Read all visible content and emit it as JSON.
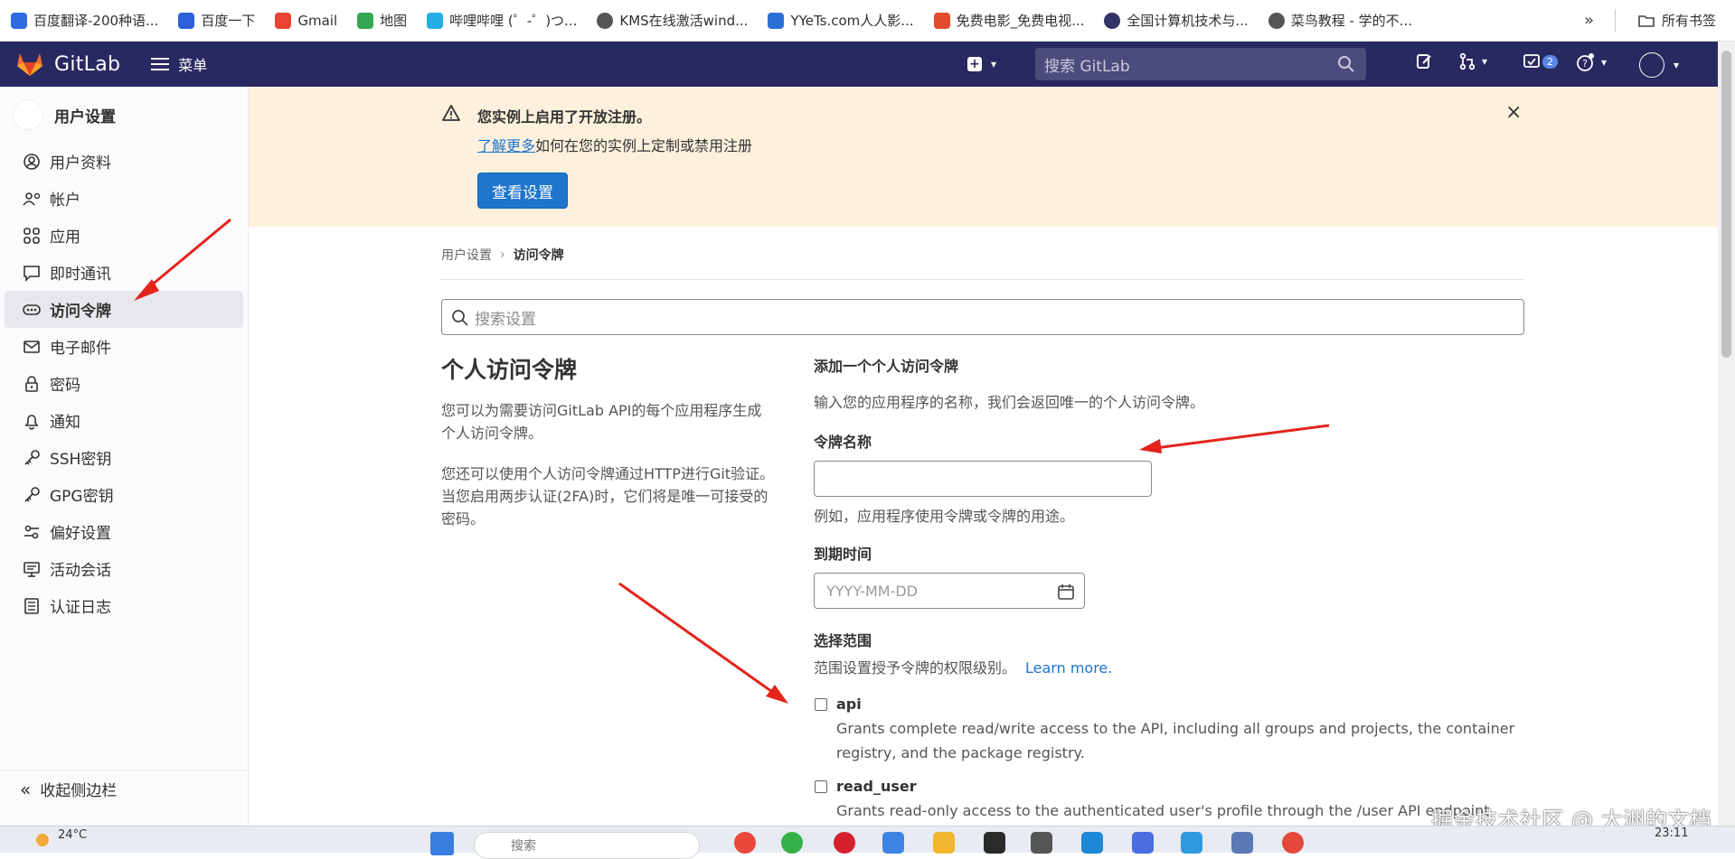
{
  "bookmarks": {
    "items": [
      {
        "label": "百度翻译-200种语...",
        "icon": "translate-icon",
        "color": "#2f6be4"
      },
      {
        "label": "百度一下",
        "icon": "paw-icon",
        "color": "#2f5fd9"
      },
      {
        "label": "Gmail",
        "icon": "gmail-icon",
        "color": "#ea4335"
      },
      {
        "label": "地图",
        "icon": "map-pin-icon",
        "color": "#34a853"
      },
      {
        "label": "哔哩哔哩 (゜-゜)つ...",
        "icon": "bilibili-icon",
        "color": "#23ade5"
      },
      {
        "label": "KMS在线激活wind...",
        "icon": "globe-icon",
        "color": "#555555"
      },
      {
        "label": "YYeTs.com人人影...",
        "icon": "yyets-icon",
        "color": "#2b6fd6"
      },
      {
        "label": "免费电影_免费电视...",
        "icon": "film-icon",
        "color": "#e24b2b"
      },
      {
        "label": "全国计算机技术与...",
        "icon": "seal-icon",
        "color": "#333366"
      },
      {
        "label": "菜鸟教程 - 学的不...",
        "icon": "globe-icon",
        "color": "#555555"
      }
    ],
    "more": "»",
    "all_bookmarks": "所有书签"
  },
  "topnav": {
    "brand": "GitLab",
    "menu": "菜单",
    "search_placeholder": "搜索 GitLab",
    "todo_count": "2"
  },
  "sidebar": {
    "title": "用户设置",
    "items": [
      {
        "label": "用户资料",
        "icon": "profile-icon"
      },
      {
        "label": "帐户",
        "icon": "account-icon"
      },
      {
        "label": "应用",
        "icon": "applications-icon"
      },
      {
        "label": "即时通讯",
        "icon": "chat-icon"
      },
      {
        "label": "访问令牌",
        "icon": "token-icon",
        "active": true
      },
      {
        "label": "电子邮件",
        "icon": "email-icon"
      },
      {
        "label": "密码",
        "icon": "lock-icon"
      },
      {
        "label": "通知",
        "icon": "bell-icon"
      },
      {
        "label": "SSH密钥",
        "icon": "key-icon"
      },
      {
        "label": "GPG密钥",
        "icon": "key-icon"
      },
      {
        "label": "偏好设置",
        "icon": "preferences-icon"
      },
      {
        "label": "活动会话",
        "icon": "monitor-icon"
      },
      {
        "label": "认证日志",
        "icon": "log-icon"
      }
    ],
    "collapse_label": "收起侧边栏"
  },
  "banner": {
    "title": "您实例上启用了开放注册。",
    "link": "了解更多",
    "text": "如何在您的实例上定制或禁用注册",
    "button": "查看设置"
  },
  "breadcrumb": {
    "parent": "用户设置",
    "current": "访问令牌"
  },
  "settings_search": {
    "placeholder": "搜索设置"
  },
  "intro": {
    "title": "个人访问令牌",
    "para1": "您可以为需要访问GitLab API的每个应用程序生成个人访问令牌。",
    "para2": "您还可以使用个人访问令牌通过HTTP进行Git验证。 当您启用两步认证(2FA)时，它们将是唯一可接受的密码。"
  },
  "form": {
    "heading": "添加一个个人访问令牌",
    "description": "输入您的应用程序的名称，我们会返回唯一的个人访问令牌。",
    "name_label": "令牌名称",
    "name_value": "",
    "name_help": "例如，应用程序使用令牌或令牌的用途。",
    "expiry_label": "到期时间",
    "expiry_placeholder": "YYYY-MM-DD",
    "scope_label": "选择范围",
    "scope_help": "范围设置授予令牌的权限级别。",
    "learn_more": "Learn more.",
    "scopes": [
      {
        "name": "api",
        "checked": false,
        "description": "Grants complete read/write access to the API, including all groups and projects, the container registry, and the package registry."
      },
      {
        "name": "read_user",
        "checked": false,
        "description": "Grants read-only access to the authenticated user's profile through the /user API endpoint"
      }
    ]
  },
  "watermark": "掘金技术社区 @ 大洲的文档",
  "taskbar": {
    "weather": "24°C",
    "search": "搜索",
    "time": "23:11"
  },
  "colors": {
    "nav_bg": "#292961",
    "banner_bg": "#fdf1dd",
    "primary": "#1f75cb",
    "arrow": "#e3241b"
  }
}
